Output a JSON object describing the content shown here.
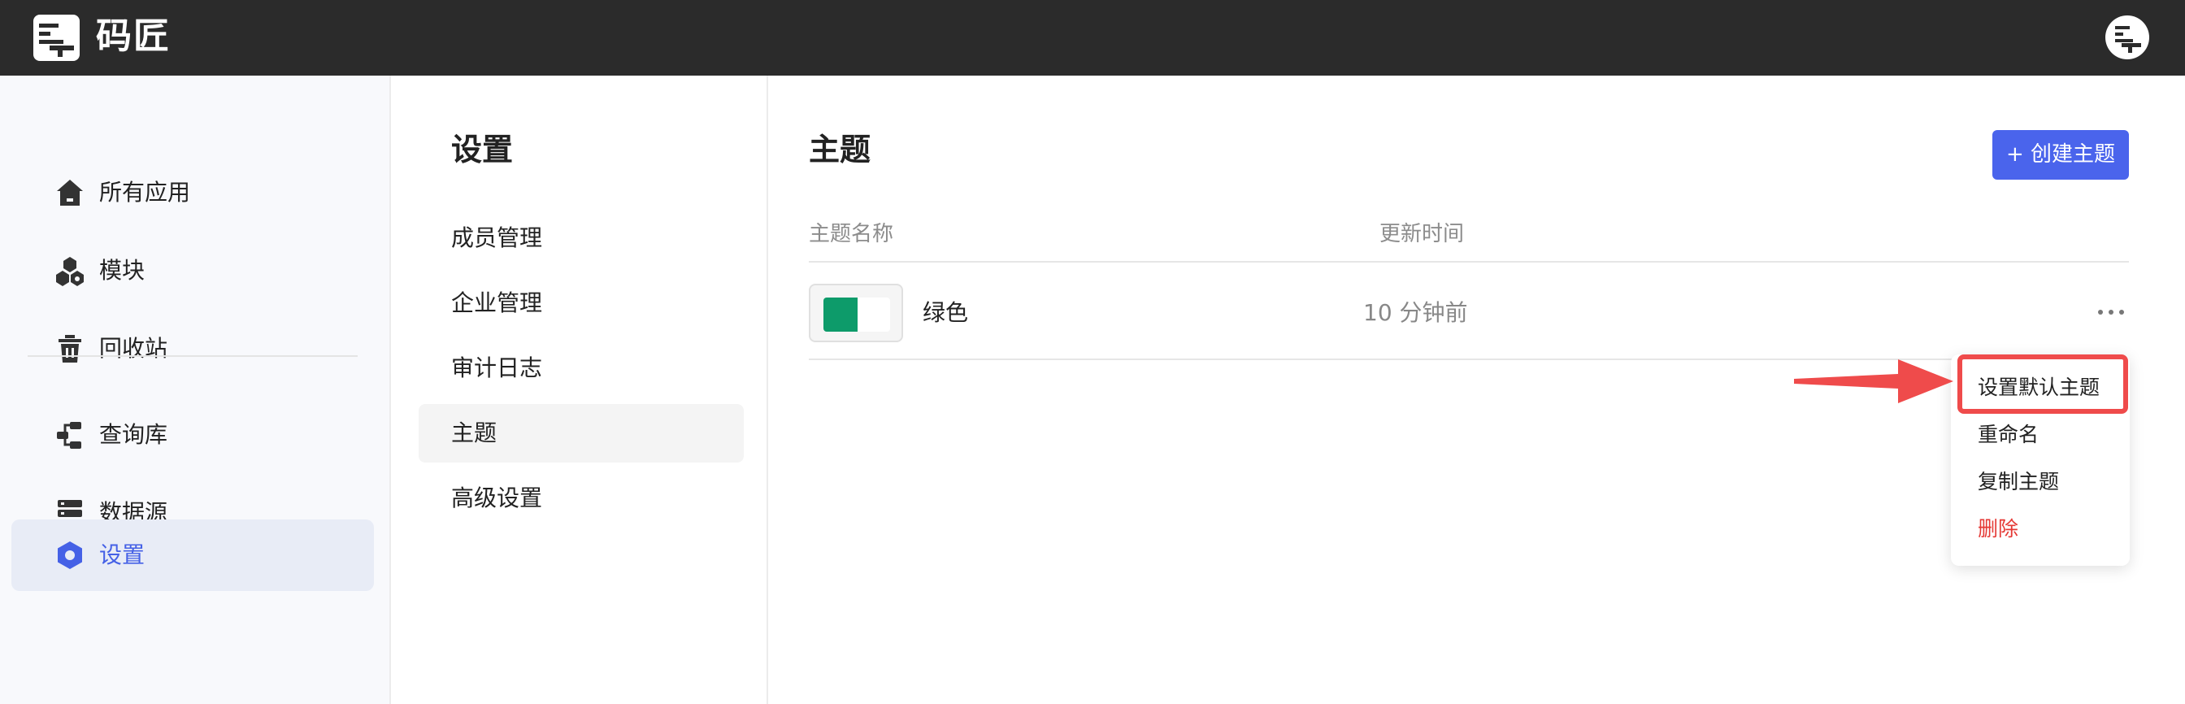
{
  "app": {
    "brand_name": "码匠"
  },
  "sidebar": {
    "items": [
      {
        "label": "所有应用",
        "icon": "home-icon"
      },
      {
        "label": "模块",
        "icon": "modules-icon"
      },
      {
        "label": "回收站",
        "icon": "trash-icon"
      },
      {
        "label": "查询库",
        "icon": "query-library-icon"
      },
      {
        "label": "数据源",
        "icon": "database-icon"
      },
      {
        "label": "设置",
        "icon": "settings-icon",
        "active": true
      }
    ]
  },
  "settings_menu": {
    "title": "设置",
    "items": [
      {
        "label": "成员管理"
      },
      {
        "label": "企业管理"
      },
      {
        "label": "审计日志"
      },
      {
        "label": "主题",
        "active": true
      },
      {
        "label": "高级设置"
      }
    ]
  },
  "main": {
    "title": "主题",
    "create_button": "+ 创建主题",
    "columns": [
      "主题名称",
      "更新时间"
    ],
    "rows": [
      {
        "name": "绿色",
        "updated": "10 分钟前",
        "swatch_colors": [
          "#0d9b6a",
          "#ffffff"
        ]
      }
    ]
  },
  "dropdown": {
    "items": [
      {
        "label": "设置默认主题"
      },
      {
        "label": "重命名"
      },
      {
        "label": "复制主题"
      },
      {
        "label": "删除",
        "danger": true
      }
    ]
  },
  "colors": {
    "topbar": "#2b2b2b",
    "accent": "#4a64ec",
    "active_nav_bg": "#e8ecf6",
    "danger": "#e53935",
    "annotation": "#ef4b4b"
  }
}
